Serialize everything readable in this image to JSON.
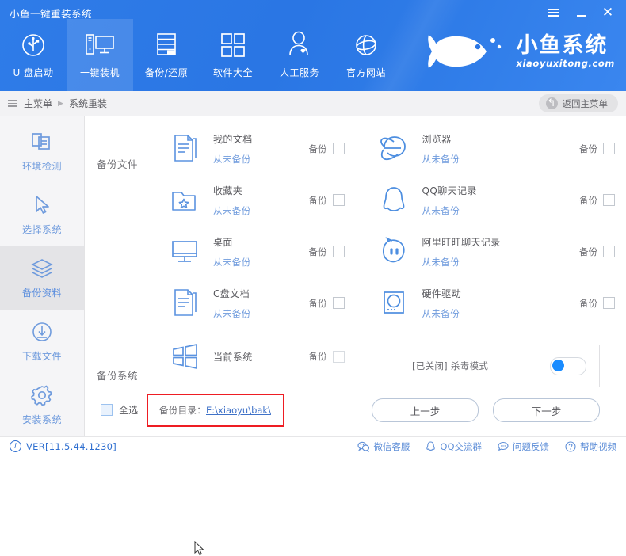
{
  "window": {
    "app_title": "小鱼一键重装系统",
    "controls": [
      {
        "name": "menu-button",
        "label": "≡"
      },
      {
        "name": "minimize-button",
        "label": "–"
      },
      {
        "name": "close-button",
        "label": "✕"
      }
    ]
  },
  "nav": {
    "items": [
      {
        "label": "U 盘启动",
        "icon": "usb-icon",
        "active": false
      },
      {
        "label": "一键装机",
        "icon": "desktop-pc-icon",
        "active": true
      },
      {
        "label": "备份/还原",
        "icon": "server-stack-icon",
        "active": false
      },
      {
        "label": "软件大全",
        "icon": "grid-squares-icon",
        "active": false
      },
      {
        "label": "人工服务",
        "icon": "person-heart-icon",
        "active": false
      },
      {
        "label": "官方网站",
        "icon": "globe-icon",
        "active": false
      }
    ]
  },
  "brand": {
    "cn": "小鱼系统",
    "en": "xiaoyuxitong.com",
    "logo": "fish-logo-icon"
  },
  "breadcrumb": {
    "menu_icon": "list-menu-icon",
    "root": "主菜单",
    "separator": "▶",
    "current": "系统重装",
    "back_button": "返回主菜单",
    "back_icon": "undo-arrow-icon"
  },
  "sidebar": {
    "items": [
      {
        "label": "环境检测",
        "icon": "layers-copy-icon",
        "active": false
      },
      {
        "label": "选择系统",
        "icon": "cursor-arrow-icon",
        "active": false
      },
      {
        "label": "备份资料",
        "icon": "stacked-sheets-icon",
        "active": true
      },
      {
        "label": "下载文件",
        "icon": "download-circle-icon",
        "active": false
      },
      {
        "label": "安装系统",
        "icon": "gear-icon",
        "active": false
      }
    ]
  },
  "main": {
    "section_files_label": "备份文件",
    "section_system_label": "备份系统",
    "backup_checkbox_label": "备份",
    "never_backed_up": "从未备份",
    "files_left": [
      {
        "name": "我的文档",
        "status": "从未备份",
        "icon": "documents-icon",
        "checked": false
      },
      {
        "name": "收藏夹",
        "status": "从未备份",
        "icon": "folder-star-icon",
        "checked": false
      },
      {
        "name": "桌面",
        "status": "从未备份",
        "icon": "monitor-icon",
        "checked": false
      },
      {
        "name": "C盘文档",
        "status": "从未备份",
        "icon": "documents-icon",
        "checked": false
      }
    ],
    "files_right": [
      {
        "name": "浏览器",
        "status": "从未备份",
        "icon": "browser-ie-icon",
        "checked": false
      },
      {
        "name": "QQ聊天记录",
        "status": "从未备份",
        "icon": "qq-penguin-icon",
        "checked": false
      },
      {
        "name": "阿里旺旺聊天记录",
        "status": "从未备份",
        "icon": "aliwangwang-icon",
        "checked": false
      },
      {
        "name": "硬件驱动",
        "status": "从未备份",
        "icon": "hard-drive-icon",
        "checked": false
      }
    ],
    "system_row": {
      "name": "当前系统",
      "icon": "windows-logo-icon",
      "checked": false
    },
    "antivirus": {
      "label": "[已关闭] 杀毒模式",
      "enabled": false
    },
    "select_all": {
      "label": "全选",
      "checked": false
    },
    "backup_dir": {
      "label": "备份目录：",
      "path": "E:\\xiaoyu\\bak\\"
    },
    "buttons": {
      "prev": "上一步",
      "next": "下一步"
    }
  },
  "status_bar": {
    "version": "VER[11.5.44.1230]",
    "links": [
      {
        "label": "微信客服",
        "icon": "wechat-icon"
      },
      {
        "label": "QQ交流群",
        "icon": "qq-penguin-icon"
      },
      {
        "label": "问题反馈",
        "icon": "chat-bubble-icon"
      },
      {
        "label": "帮助视频",
        "icon": "question-circle-icon"
      }
    ]
  },
  "colors": {
    "header_blue": "#2a76e4",
    "accent_blue": "#6f9bdd",
    "link_blue": "#3f72c8",
    "alert_red": "#ee1d23",
    "toggle_on_blue": "#1a8cff",
    "sidebar_bg": "#f5f5f7"
  }
}
